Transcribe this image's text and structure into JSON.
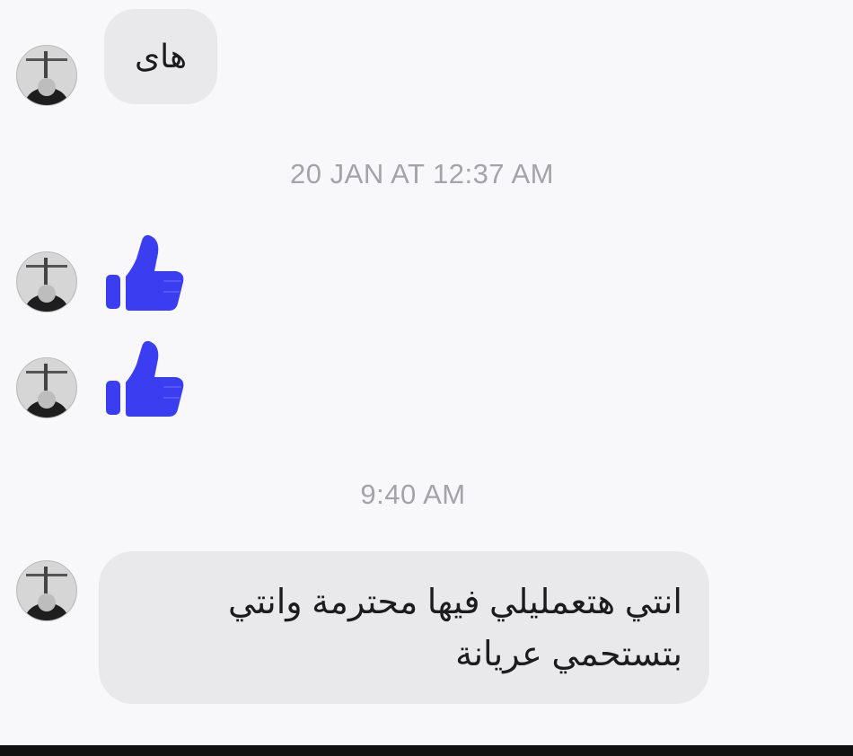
{
  "conversation": {
    "messages": [
      {
        "type": "text",
        "text": "هاى"
      },
      {
        "type": "timestamp",
        "text": "20 JAN AT 12:37 AM"
      },
      {
        "type": "like",
        "icon": "thumbs-up-icon"
      },
      {
        "type": "like",
        "icon": "thumbs-up-icon"
      },
      {
        "type": "timestamp",
        "text": "9:40 AM"
      },
      {
        "type": "text",
        "line1": "انتي هتعمليلي فيها محترمة وانتي",
        "line2": "بتستحمي عريانة"
      }
    ]
  },
  "colors": {
    "background": "#f8f8fa",
    "bubble": "#e9e9ec",
    "like_blue": "#3b3df0",
    "timestamp": "#a4a4a8"
  }
}
